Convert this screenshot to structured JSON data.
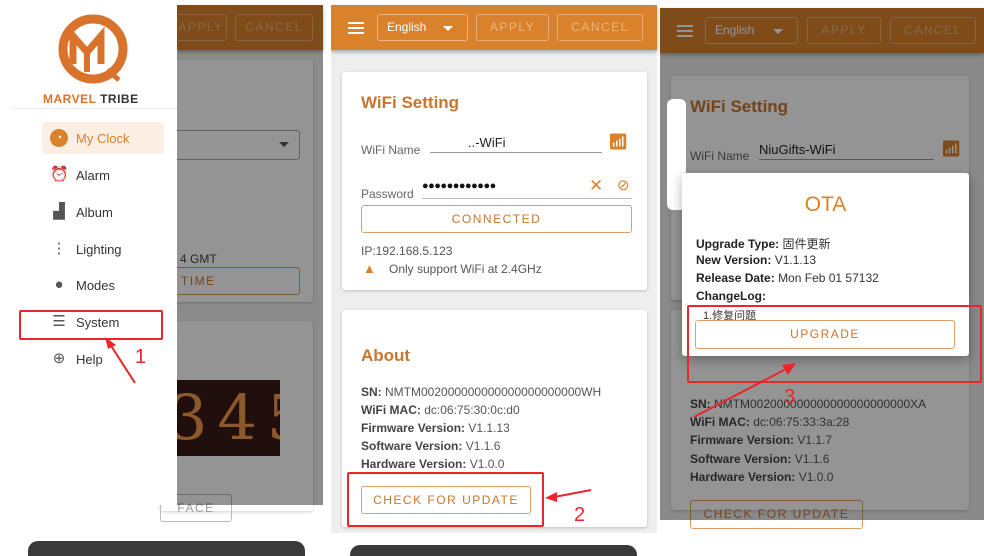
{
  "header": {
    "language": "English",
    "apply": "APPLY",
    "cancel": "CANCEL"
  },
  "panel1": {
    "brand": {
      "word1": "MARVEL",
      "word2": "TRIBE"
    },
    "menu": [
      {
        "label": "My Clock",
        "icon": "clock-icon",
        "active": true
      },
      {
        "label": "Alarm",
        "icon": "alarm-icon"
      },
      {
        "label": "Album",
        "icon": "album-icon"
      },
      {
        "label": "Lighting",
        "icon": "traffic-light-icon"
      },
      {
        "label": "Modes",
        "icon": "palette-icon"
      },
      {
        "label": "System",
        "icon": "sliders-icon"
      },
      {
        "label": "Help",
        "icon": "lifebuoy-icon"
      }
    ],
    "background": {
      "gmt": "4 GMT",
      "time_button": "TIME",
      "face_button": "FACE",
      "nixie_digits": "345"
    },
    "step": "1"
  },
  "panel2": {
    "wifi": {
      "title": "WiFi Setting",
      "name_label": "WiFi Name",
      "name_value": "..-WiFi",
      "password_label": "Password",
      "password_value": "●●●●●●●●●●●●",
      "connected": "CONNECTED",
      "ip": "IP:192.168.5.123",
      "warning": "Only support WiFi at 2.4GHz"
    },
    "about": {
      "title": "About",
      "rows": [
        {
          "k": "SN:",
          "v": "NMTM002000000000000000000000WH"
        },
        {
          "k": "WiFi MAC:",
          "v": "dc:06:75:30:0c:d0"
        },
        {
          "k": "Firmware Version:",
          "v": "V1.1.13"
        },
        {
          "k": "Software Version:",
          "v": "V1.1.6"
        },
        {
          "k": "Hardware Version:",
          "v": "V1.0.0"
        }
      ],
      "check": "CHECK FOR UPDATE"
    },
    "step": "2"
  },
  "panel3": {
    "wifi": {
      "title": "WiFi Setting",
      "name_label": "WiFi Name",
      "name_value": "NiuGifts-WiFi"
    },
    "about": {
      "rows": [
        {
          "k": "SN:",
          "v": "NMTM002000000000000000000000XA"
        },
        {
          "k": "WiFi MAC:",
          "v": "dc:06:75:33:3a:28"
        },
        {
          "k": "Firmware Version:",
          "v": "V1.1.7"
        },
        {
          "k": "Software Version:",
          "v": "V1.1.6"
        },
        {
          "k": "Hardware Version:",
          "v": "V1.0.0"
        }
      ],
      "check": "CHECK FOR UPDATE"
    },
    "ota": {
      "title": "OTA",
      "rows": [
        {
          "k": "Upgrade Type:",
          "v": "固件更新"
        },
        {
          "k": "New Version:",
          "v": "V1.1.13"
        },
        {
          "k": "Release Date:",
          "v": "Mon Feb 01 57132"
        },
        {
          "k": "ChangeLog:",
          "v": ""
        }
      ],
      "changelog": "1.修复问题",
      "upgrade": "UPGRADE"
    },
    "step": "3"
  },
  "colors": {
    "accent": "#d9822b",
    "title": "#c8752f",
    "annotation": "#e8262b"
  }
}
